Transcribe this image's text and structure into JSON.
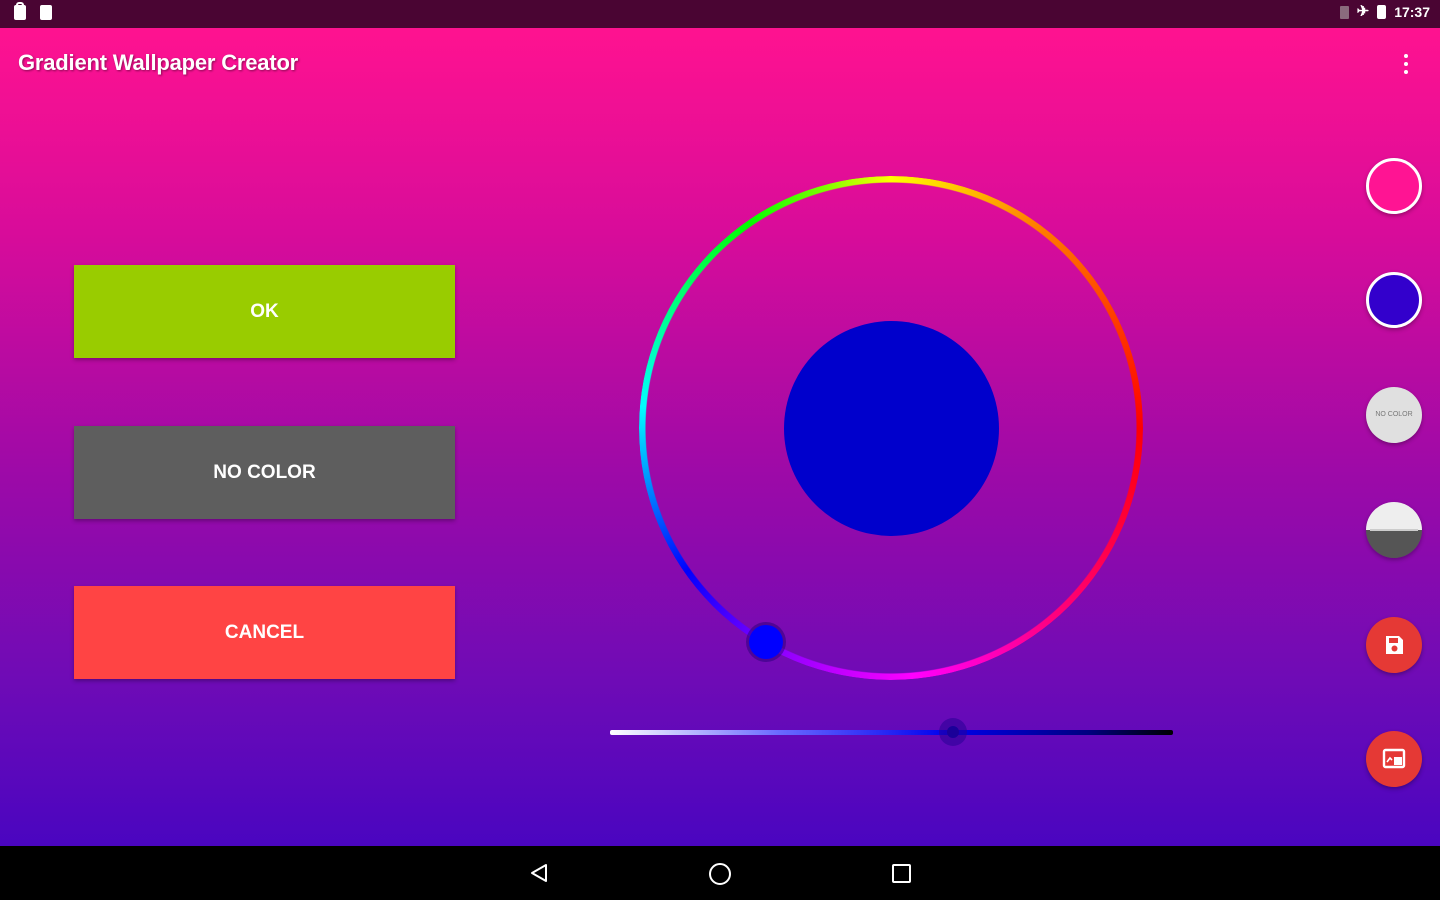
{
  "status_bar": {
    "time": "17:37",
    "left_icons": [
      "notification-icon",
      "android-icon"
    ],
    "right_icons": [
      "sim-icon",
      "airplane-icon",
      "battery-icon"
    ]
  },
  "app_bar": {
    "title": "Gradient Wallpaper Creator",
    "menu_icon": "overflow-menu-icon"
  },
  "dialog_buttons": {
    "ok_label": "OK",
    "no_color_label": "NO COLOR",
    "cancel_label": "CANCEL"
  },
  "color_picker": {
    "selected_color": "#0000cc",
    "value_slider": 0.61
  },
  "side_actions": {
    "color_1": "#ff1493",
    "color_2": "#3300cc",
    "no_color_circle_label": "NO COLOR",
    "buttons": [
      "pink-swatch",
      "indigo-swatch",
      "no-color-swatch",
      "half-tone-swatch",
      "save-icon",
      "set-wallpaper-icon"
    ]
  },
  "colors": {
    "status_bar": "#4a0533",
    "gradient_top": "#ff1290",
    "gradient_bottom": "#4a05c0",
    "ok_green": "#99cc00",
    "no_color_gray": "#5e5e5e",
    "cancel_red": "#ff4444",
    "action_red": "#e53935"
  },
  "nav_bar": {
    "icons": [
      "back-icon",
      "home-icon",
      "recents-icon"
    ]
  }
}
